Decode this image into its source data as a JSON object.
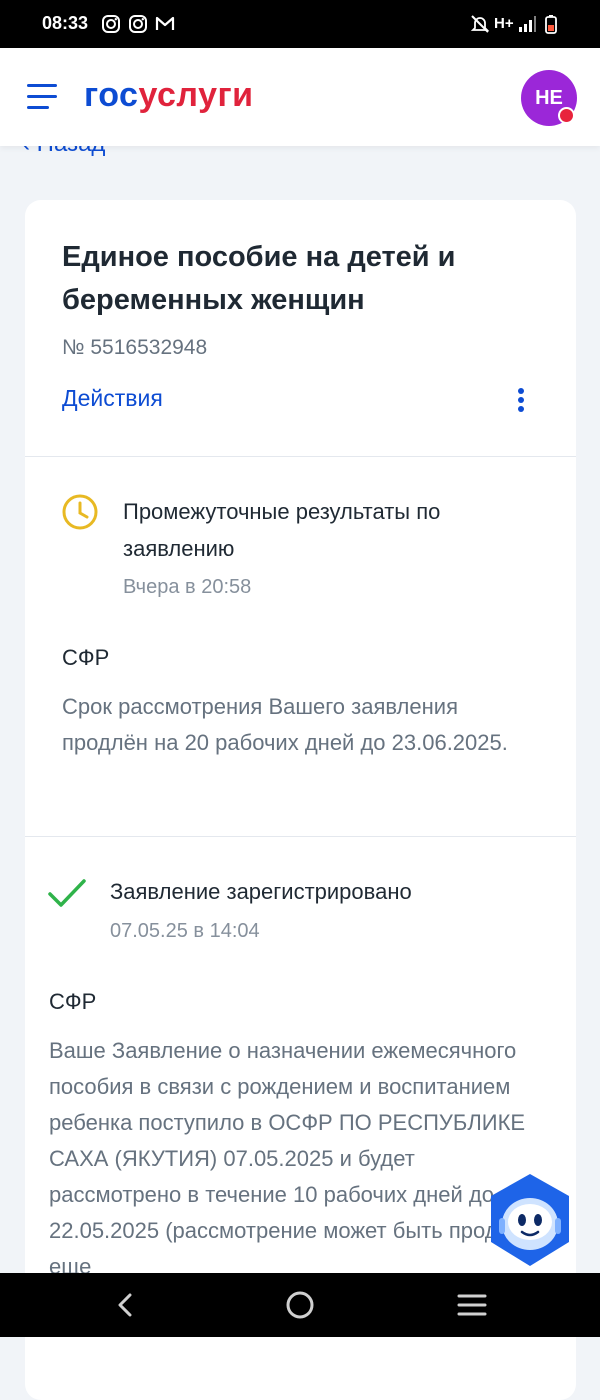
{
  "status_bar": {
    "time": "08:33",
    "left_icons": [
      "instagram-icon",
      "instagram-icon",
      "gmail-icon"
    ],
    "right_icons": [
      "mute-icon",
      "network-type-icon",
      "signal-icon",
      "battery-icon"
    ],
    "network_label": "H+"
  },
  "header": {
    "logo_part1": "гос",
    "logo_part2": "услуги",
    "avatar_initials": "НЕ",
    "brand_blue": "#0d4cd3",
    "brand_red": "#e0233c"
  },
  "back_label": "‹ Назад",
  "application": {
    "title": "Единое пособие на детей и беременных женщин",
    "number": "№ 5516532948",
    "actions_label": "Действия"
  },
  "events": [
    {
      "icon": "clock-icon",
      "status": "Промежуточные результаты по заявлению",
      "date": "Вчера в 20:58",
      "org": "СФР",
      "description": "Срок рассмотрения Вашего заявления продлён на 20 рабочих дней до 23.06.2025."
    },
    {
      "icon": "check-icon",
      "status": "Заявление зарегистрировано",
      "date": "07.05.25 в 14:04",
      "org": "СФР",
      "description": "Ваше Заявление о назначении ежемесячного пособия в связи с рождением и воспитанием ребенка поступило в ОСФР ПО РЕСПУБЛИКЕ САХА (ЯКУТИЯ) 07.05.2025 и будет рассмотрено в течение 10 рабочих дней до 22.05.2025 (рассмотрение может быть продлено еще"
    }
  ],
  "nav_bar": {
    "icons": [
      "back-nav-icon",
      "home-nav-icon",
      "recents-nav-icon"
    ]
  }
}
